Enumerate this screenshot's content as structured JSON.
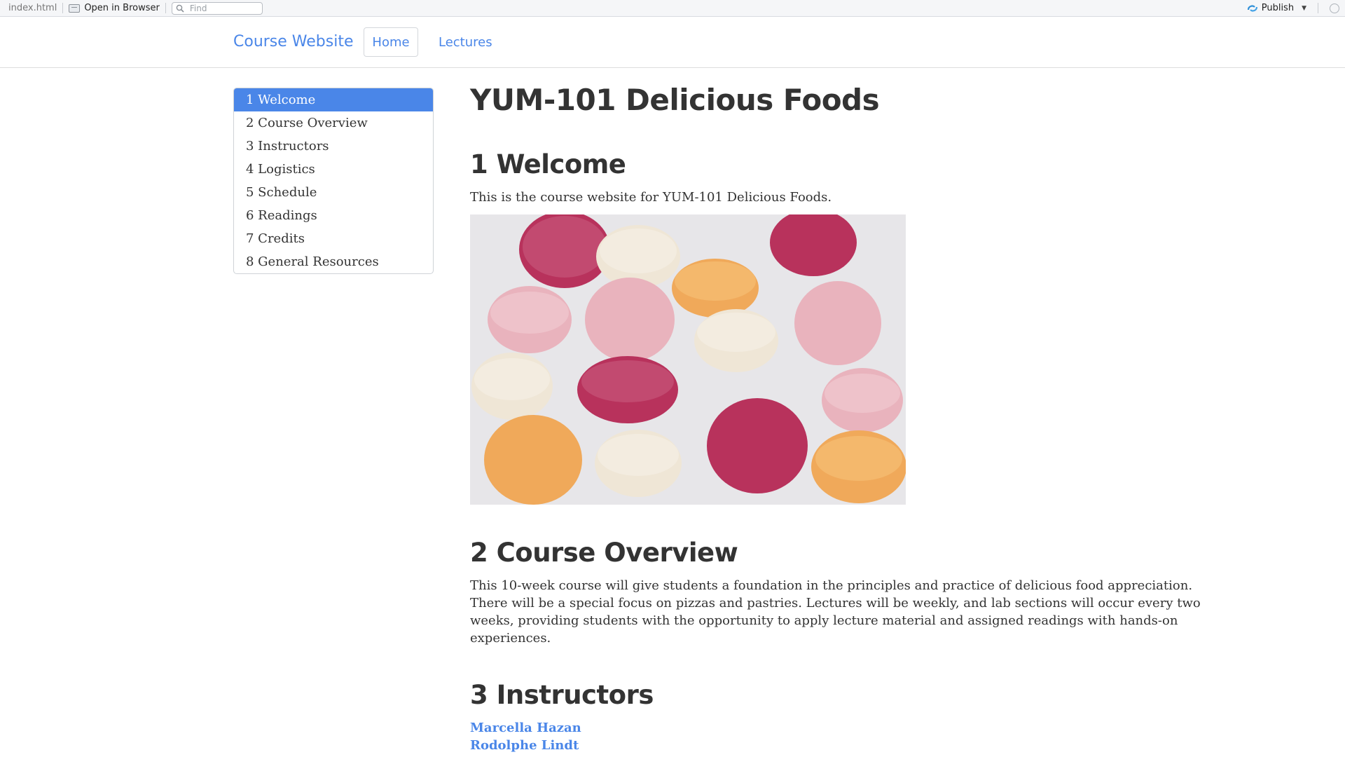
{
  "toolbar": {
    "file_name": "index.html",
    "open_in_browser": "Open in Browser",
    "find_placeholder": "Find",
    "publish": "Publish"
  },
  "navbar": {
    "brand": "Course Website",
    "items": [
      {
        "label": "Home",
        "active": true
      },
      {
        "label": "Lectures",
        "active": false
      }
    ]
  },
  "toc": {
    "items": [
      {
        "label": "1 Welcome",
        "active": true
      },
      {
        "label": "2 Course Overview",
        "active": false
      },
      {
        "label": "3 Instructors",
        "active": false
      },
      {
        "label": "4 Logistics",
        "active": false
      },
      {
        "label": "5 Schedule",
        "active": false
      },
      {
        "label": "6 Readings",
        "active": false
      },
      {
        "label": "7 Credits",
        "active": false
      },
      {
        "label": "8 General Resources",
        "active": false
      }
    ]
  },
  "main": {
    "title": "YUM-101 Delicious Foods",
    "welcome": {
      "heading": "1 Welcome",
      "text": "This is the course website for YUM-101 Delicious Foods."
    },
    "overview": {
      "heading": "2 Course Overview",
      "lines": [
        "This 10-week course will give students a foundation in the principles and practice of delicious food appreciation.",
        "There will be a special focus on pizzas and pastries. Lectures will be weekly, and lab sections will occur every two",
        "weeks, providing students with the opportunity to apply lecture material and assigned readings with hands-on",
        "experiences."
      ]
    },
    "instructors": {
      "heading": "3 Instructors",
      "names": [
        "Marcella Hazan",
        "Rodolphe Lindt"
      ]
    }
  },
  "colors": {
    "accent": "#4a86e8",
    "text": "#333333",
    "photo_background": "#e7e6e9",
    "macaron_raspberry": "#b8325c",
    "macaron_pink": "#e9b3bd",
    "macaron_cream": "#efe6d6",
    "macaron_orange": "#f0a95a"
  }
}
